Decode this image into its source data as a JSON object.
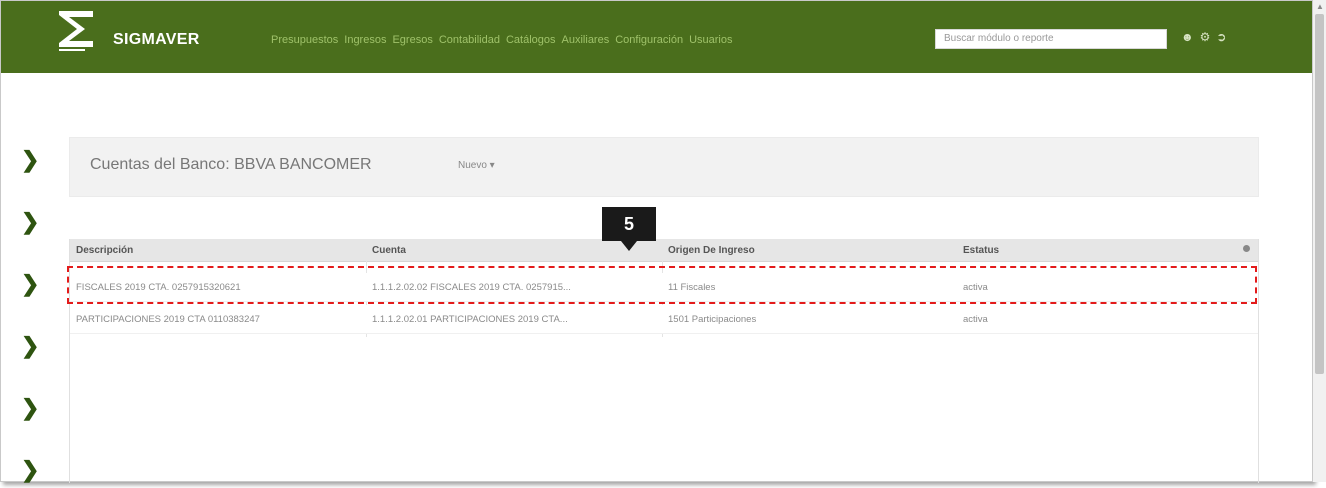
{
  "navbar": {
    "brand": "SIGMAVER",
    "menu": [
      "Presupuestos",
      "Ingresos",
      "Egresos",
      "Contabilidad",
      "Catálogos",
      "Auxiliares",
      "Configuración",
      "Usuarios"
    ],
    "search_placeholder": "Buscar módulo o reporte",
    "icons": [
      "user-icon",
      "gear-icon",
      "logout-icon"
    ],
    "color": "#4a6e1c"
  },
  "page": {
    "title": "Cuentas del Banco: BBVA BANCOMER",
    "new_button": "Nuevo ▾"
  },
  "table": {
    "headers": [
      "Descripción",
      "Cuenta",
      "Origen De Ingreso",
      "Estatus"
    ],
    "rows": [
      [
        "FISCALES 2019 CTA. 0257915320621",
        "1.1.1.2.02.02 FISCALES 2019 CTA. 0257915...",
        "11 Fiscales",
        "activa"
      ],
      [
        "PARTICIPACIONES 2019 CTA 0110383247",
        "1.1.1.2.02.01 PARTICIPACIONES 2019 CTA...",
        "1501 Participaciones",
        "activa"
      ]
    ]
  },
  "annotation": {
    "callout_label": "5",
    "highlight_color": "#e31b1b"
  },
  "sidebar": {
    "chevron_icon": "chevron-right-icon",
    "count": 6
  }
}
